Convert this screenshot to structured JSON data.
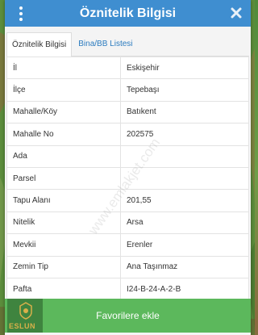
{
  "header": {
    "title": "Öznitelik Bilgisi"
  },
  "tabs": [
    {
      "label": "Öznitelik Bilgisi",
      "active": true
    },
    {
      "label": "Bina/BB Listesi",
      "active": false
    }
  ],
  "attributes": [
    {
      "key": "İl",
      "value": "Eskişehir"
    },
    {
      "key": "İlçe",
      "value": "Tepebaşı"
    },
    {
      "key": "Mahalle/Köy",
      "value": "Batıkent"
    },
    {
      "key": "Mahalle No",
      "value": "202575"
    },
    {
      "key": "Ada",
      "value": ""
    },
    {
      "key": "Parsel",
      "value": ""
    },
    {
      "key": "Tapu Alanı",
      "value": "201,55"
    },
    {
      "key": "Nitelik",
      "value": "Arsa"
    },
    {
      "key": "Mevkii",
      "value": "Erenler"
    },
    {
      "key": "Zemin Tip",
      "value": "Ana Taşınmaz"
    },
    {
      "key": "Pafta",
      "value": "I24-B-24-A-2-B"
    }
  ],
  "footer": {
    "button_label": "Favorilere ekle"
  },
  "watermark": {
    "text": "www.emlakjet.com"
  },
  "logo": {
    "text": "ESLUN"
  },
  "colors": {
    "header": "#3f8ed0",
    "button": "#5cb85c",
    "tab_link": "#2b7bbf"
  },
  "icons": [
    "menu-dots-icon",
    "close-icon",
    "logo-seal-icon"
  ]
}
